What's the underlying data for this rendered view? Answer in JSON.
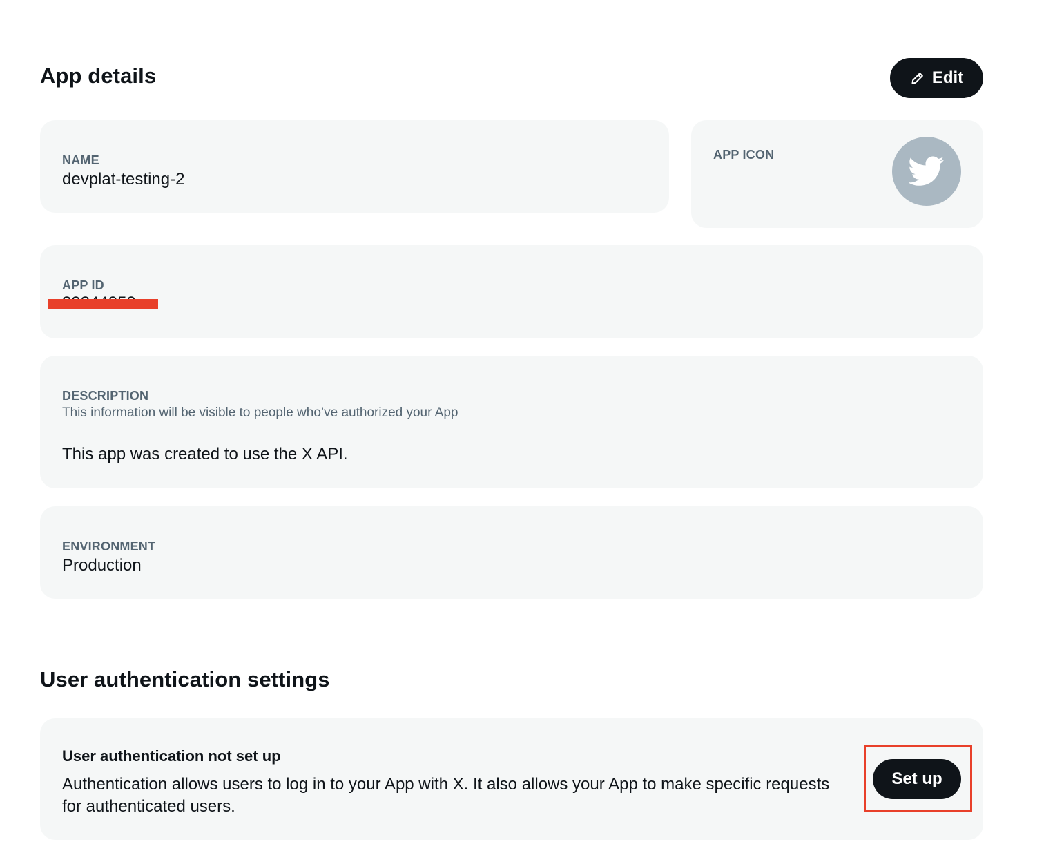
{
  "app_details": {
    "title": "App details",
    "edit_button": {
      "label": "Edit",
      "icon": "pencil-icon"
    },
    "name": {
      "label": "NAME",
      "value": "devplat-testing-2"
    },
    "app_icon": {
      "label": "APP ICON",
      "icon": "twitter-bird-icon"
    },
    "app_id": {
      "label": "APP ID",
      "value": "29344050",
      "redacted": true
    },
    "description": {
      "label": "DESCRIPTION",
      "hint": "This information will be visible to people who’ve authorized your App",
      "value": "This app was created to use the X API."
    },
    "environment": {
      "label": "ENVIRONMENT",
      "value": "Production"
    }
  },
  "user_auth": {
    "title": "User authentication settings",
    "status_title": "User authentication not set up",
    "status_description": "Authentication allows users to log in to your App with X. It also allows your App to make specific requests for authenticated users.",
    "setup_button": {
      "label": "Set up"
    }
  },
  "colors": {
    "primary_button": "#0f1419",
    "card_background": "#f5f7f7",
    "label_gray": "#536471",
    "highlight_red": "#e8402a",
    "icon_background": "#aab8c2"
  }
}
